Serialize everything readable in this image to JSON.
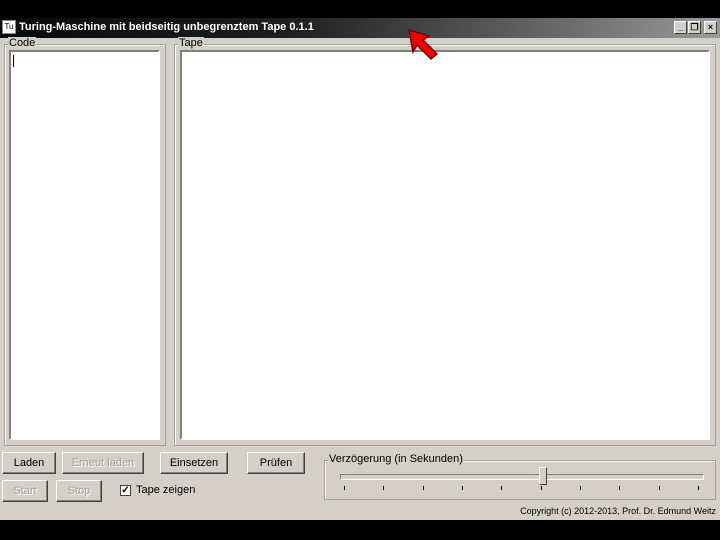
{
  "window": {
    "title": "Turing-Maschine mit beidseitig unbegrenztem Tape 0.1.1",
    "icon_label": "Tu",
    "controls": {
      "minimize": "_",
      "restore": "❐",
      "close": "×"
    }
  },
  "code_panel": {
    "label": "Code",
    "value": ""
  },
  "tape_panel": {
    "label": "Tape",
    "value": ""
  },
  "buttons": {
    "laden": "Laden",
    "erneut_laden": "Erneut laden",
    "einsetzen": "Einsetzen",
    "pruefen": "Prüfen",
    "start": "Start",
    "stop": "Stop"
  },
  "tape_zeigen": {
    "label": "Tape zeigen",
    "checked": true
  },
  "delay": {
    "label": "Verzögerung (in Sekunden)",
    "position_fraction": 0.56,
    "tick_count": 10
  },
  "status": {
    "copyright": "Copyright (c) 2012-2013, Prof. Dr. Edmund Weitz"
  },
  "icons": {
    "cursor": "mouse-pointer-icon",
    "check": "checkmark-icon"
  },
  "colors": {
    "cursor": "#ee0000",
    "face": "#d4d0c8"
  }
}
